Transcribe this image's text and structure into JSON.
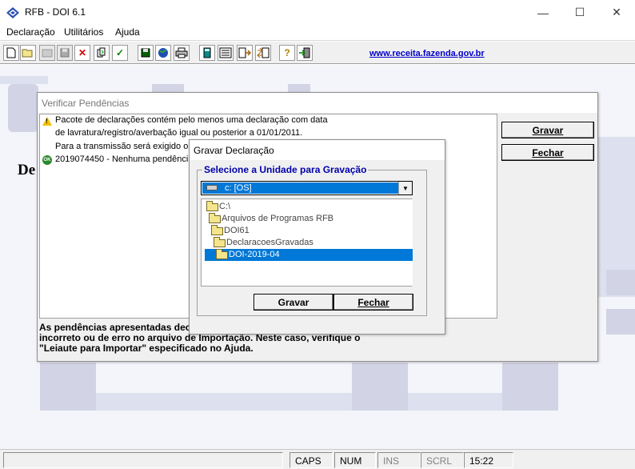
{
  "window": {
    "title": "RFB - DOI 6.1",
    "minimize_glyph": "—",
    "maximize_glyph": "☐",
    "close_glyph": "✕"
  },
  "menu": {
    "items": [
      "Declaração",
      "Utilitários",
      "Ajuda"
    ]
  },
  "toolbar": {
    "icons": [
      "new-icon",
      "open-icon",
      "disabled-icon",
      "save-icon",
      "delete-icon",
      "copy-icon",
      "validate-icon",
      "save-disk-icon",
      "internet-icon",
      "print-icon",
      "calculator-icon",
      "form-icon",
      "import-icon",
      "export-icon",
      "help-icon",
      "exit-icon"
    ],
    "link": "www.receita.fazenda.gov.br"
  },
  "background": {
    "text": "De"
  },
  "pendencias_dialog": {
    "title": "Verificar Pendências",
    "messages": [
      "Pacote de declarações contém pelo menos uma declaração com data",
      "de lavratura/registro/averbação igual ou posterior a 01/01/2011.",
      "Para a transmissão será exigido o ce",
      "2019074450 - Nenhuma pendência"
    ],
    "ok_icon_text": "OK",
    "note_lines": [
      "As pendências apresentadas dec",
      "incorreto ou de erro no arquivo de Importação. Neste caso, verifique o",
      "\"Leiaute para Importar\" especificado no Ajuda."
    ],
    "gravar_button": "Gravar",
    "fechar_button": "Fechar"
  },
  "gravar_dialog": {
    "title": "Gravar Declaração",
    "group_label": "Selecione a Unidade para Gravação",
    "drive_value": "c: [OS]",
    "directories": [
      {
        "name": "C:\\",
        "selected": false
      },
      {
        "name": "Arquivos de Programas RFB",
        "selected": false
      },
      {
        "name": "DOI61",
        "selected": false
      },
      {
        "name": "DeclaracoesGravadas",
        "selected": false
      },
      {
        "name": "DOI-2019-04",
        "selected": true
      }
    ],
    "gravar_button": "Gravar",
    "fechar_button": "Fechar"
  },
  "statusbar": {
    "caps": "CAPS",
    "num": "NUM",
    "ins": "INS",
    "scrl": "SCRL",
    "time": "15:22"
  },
  "colors": {
    "selection": "#0078d7",
    "link": "#0000cc",
    "group_label": "#0000aa",
    "background_shape": "#d2d4e6"
  }
}
